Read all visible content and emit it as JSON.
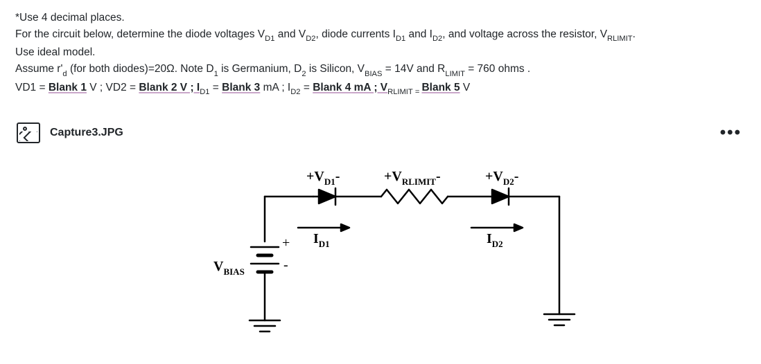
{
  "problem": {
    "line1_prefix": "*Use 4 decimal places.",
    "line2_a": "For the circuit below, determine the diode voltages V",
    "line2_b": " and V",
    "line2_c": ",  diode currents I",
    "line2_d": " and I",
    "line2_e": ", and voltage across the resistor, V",
    "line2_f": ".",
    "sub_d1": "D1",
    "sub_d2": "D2",
    "sub_rlimit": "RLIMIT",
    "line3": "Use ideal model.",
    "line4_a": "Assume r'",
    "line4_sub_d": "d",
    "line4_b": " (for both diodes)=20Ω. Note D",
    "line4_sub_1": "1",
    "line4_c": " is Germanium, D",
    "line4_sub_2": "2",
    "line4_d": " is Silicon, V",
    "line4_sub_bias": "BIAS",
    "line4_e": " = 14V and R",
    "line4_sub_limit": "LIMIT",
    "line4_f": " = 760 ohms .",
    "line5_a": "VD1 = ",
    "blank1": "Blank 1",
    "line5_b": " V ; VD2 = ",
    "blank2": "Blank 2",
    "line5_c": " V ; I",
    "line5_d": " = ",
    "blank3": "Blank 3",
    "line5_e": " mA ; I",
    "line5_f": " = ",
    "blank4": "Blank 4",
    "line5_g": "  mA  ; V",
    "line5_h": " ",
    "blank5": "Blank 5",
    "line5_i": " V"
  },
  "attachment": {
    "filename": "Capture3.JPG",
    "more_glyph": "•••"
  },
  "circuit": {
    "label_vd1": "+V",
    "label_vd1_sub": "D1",
    "label_vd1_suffix": "-",
    "label_vrlimit": "+V",
    "label_vrlimit_sub": "RLIMIT",
    "label_vrlimit_suffix": "-",
    "label_vd2": "+V",
    "label_vd2_sub": "D2",
    "label_vd2_suffix": "-",
    "label_id1": "I",
    "label_id1_sub": "D1",
    "label_id2": "I",
    "label_id2_sub": "D2",
    "label_vbias": "V",
    "label_vbias_sub": "BIAS",
    "label_plus": "+",
    "label_minus": "-"
  }
}
